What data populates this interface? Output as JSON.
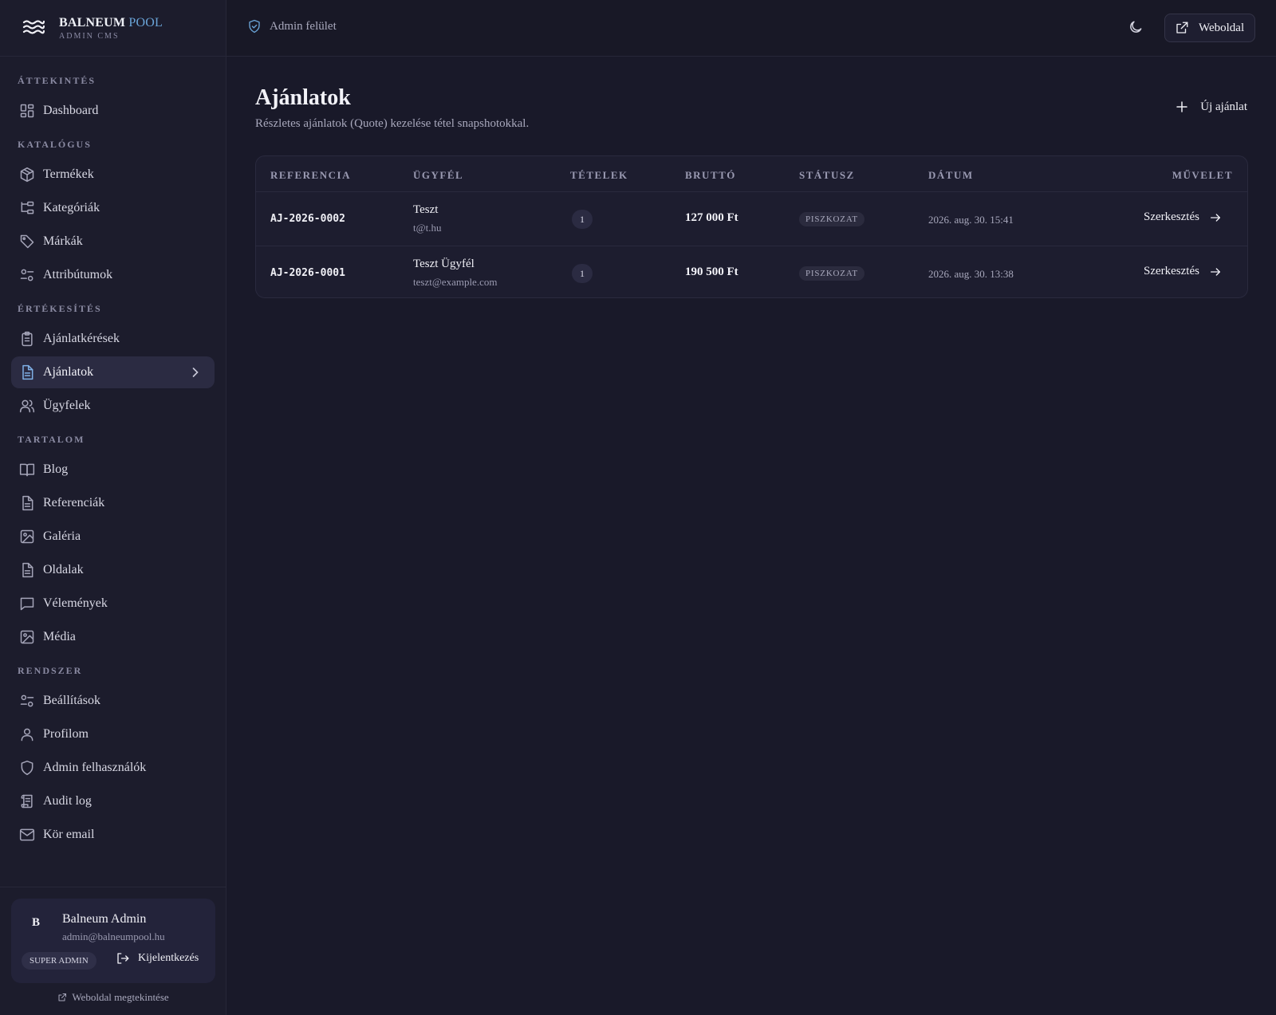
{
  "brand": {
    "name_part1": "BALNEUM",
    "name_part2": "POOL",
    "subtitle": "ADMIN CMS"
  },
  "topbar": {
    "admin_label": "Admin felület",
    "website_button": "Weboldal"
  },
  "sidebar": {
    "sections": [
      {
        "title": "ÁTTEKINTÉS",
        "items": [
          {
            "label": "Dashboard",
            "icon": "dashboard-icon"
          }
        ]
      },
      {
        "title": "KATALÓGUS",
        "items": [
          {
            "label": "Termékek",
            "icon": "package-icon"
          },
          {
            "label": "Kategóriák",
            "icon": "category-tree-icon"
          },
          {
            "label": "Márkák",
            "icon": "tag-icon"
          },
          {
            "label": "Attribútumok",
            "icon": "sliders-icon"
          }
        ]
      },
      {
        "title": "ÉRTÉKESÍTÉS",
        "items": [
          {
            "label": "Ajánlatkérések",
            "icon": "clipboard-icon"
          },
          {
            "label": "Ajánlatok",
            "icon": "file-text-icon",
            "active": true
          },
          {
            "label": "Ügyfelek",
            "icon": "users-icon"
          }
        ]
      },
      {
        "title": "TARTALOM",
        "items": [
          {
            "label": "Blog",
            "icon": "book-icon"
          },
          {
            "label": "Referenciák",
            "icon": "file-text-icon"
          },
          {
            "label": "Galéria",
            "icon": "image-icon"
          },
          {
            "label": "Oldalak",
            "icon": "file-text-icon"
          },
          {
            "label": "Vélemények",
            "icon": "message-icon"
          },
          {
            "label": "Média",
            "icon": "image-icon"
          }
        ]
      },
      {
        "title": "RENDSZER",
        "items": [
          {
            "label": "Beállítások",
            "icon": "sliders-icon"
          },
          {
            "label": "Profilom",
            "icon": "user-icon"
          },
          {
            "label": "Admin felhasználók",
            "icon": "shield-icon"
          },
          {
            "label": "Audit log",
            "icon": "scroll-icon"
          },
          {
            "label": "Kör email",
            "icon": "mail-icon"
          }
        ]
      }
    ],
    "user": {
      "initial": "B",
      "name": "Balneum Admin",
      "email": "admin@balneumpool.hu",
      "role": "SUPER ADMIN",
      "logout_label": "Kijelentkezés"
    },
    "view_site_label": "Weboldal megtekintése"
  },
  "page": {
    "title": "Ajánlatok",
    "subtitle": "Részletes ajánlatok (Quote) kezelése tétel snapshotokkal.",
    "new_button": "Új ajánlat"
  },
  "table": {
    "headers": {
      "reference": "REFERENCIA",
      "customer": "ÜGYFÉL",
      "items": "TÉTELEK",
      "gross": "BRUTTÓ",
      "status": "STÁTUSZ",
      "date": "DÁTUM",
      "action": "MŰVELET"
    },
    "rows": [
      {
        "reference": "AJ-2026-0002",
        "customer_name": "Teszt",
        "customer_email": "t@t.hu",
        "items": "1",
        "gross": "127 000 Ft",
        "status": "PISZKOZAT",
        "date": "2026. aug. 30. 15:41",
        "action": "Szerkesztés"
      },
      {
        "reference": "AJ-2026-0001",
        "customer_name": "Teszt Ügyfél",
        "customer_email": "teszt@example.com",
        "items": "1",
        "gross": "190 500 Ft",
        "status": "PISZKOZAT",
        "date": "2026. aug. 30. 13:38",
        "action": "Szerkesztés"
      }
    ]
  },
  "colors": {
    "accent": "#6aa4d8",
    "background": "#191929",
    "sidebar": "#1c1c2c",
    "active_item": "#2b2b42"
  }
}
